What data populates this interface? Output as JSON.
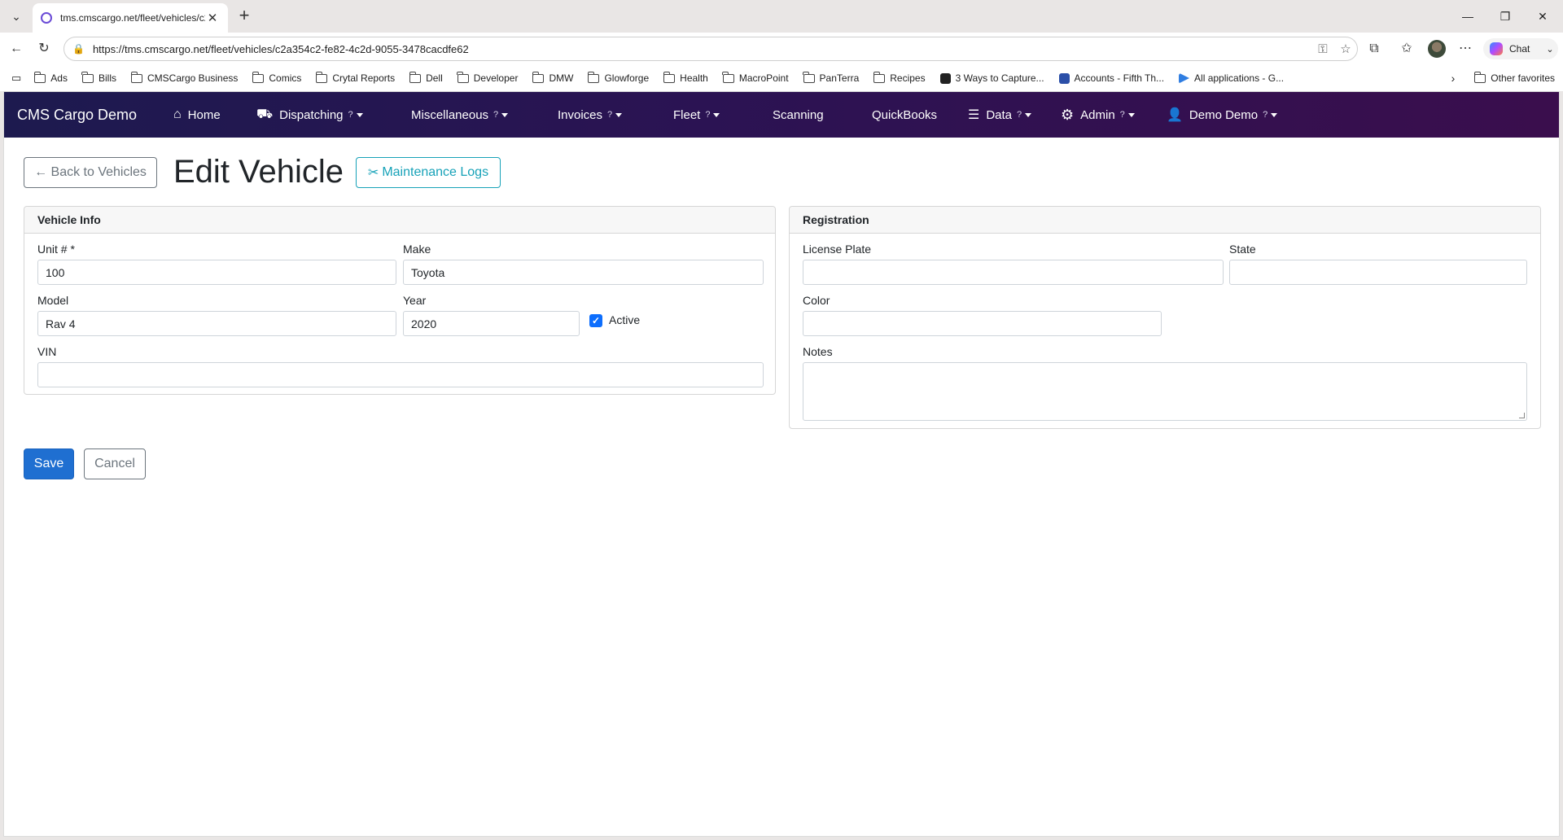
{
  "browser": {
    "tab_title": "tms.cmscargo.net/fleet/vehicles/c2",
    "url": "https://tms.cmscargo.net/fleet/vehicles/c2a354c2-fe82-4c2d-9055-3478cacdfe62",
    "chat_label": "Chat",
    "bookmarks": [
      "Ads",
      "Bills",
      "CMSCargo Business",
      "Comics",
      "Crytal Reports",
      "Dell",
      "Developer",
      "DMW",
      "Glowforge",
      "Health",
      "MacroPoint",
      "PanTerra",
      "Recipes",
      "3 Ways to Capture...",
      "Accounts - Fifth Th...",
      "All applications - G..."
    ],
    "other_favorites": "Other favorites"
  },
  "navbar": {
    "brand": "CMS Cargo Demo",
    "items": [
      {
        "label": "Home",
        "icon": "home-icon"
      },
      {
        "label": "Dispatching",
        "icon": "truck-icon",
        "help": "?"
      },
      {
        "label": "Miscellaneous",
        "help": "?"
      },
      {
        "label": "Invoices",
        "help": "?"
      },
      {
        "label": "Fleet",
        "help": "?"
      },
      {
        "label": "Scanning"
      },
      {
        "label": "QuickBooks"
      },
      {
        "label": "Data",
        "icon": "database-icon",
        "help": "?"
      },
      {
        "label": "Admin",
        "icon": "gear-icon",
        "help": "?"
      },
      {
        "label": "Demo Demo",
        "icon": "user-icon",
        "help": "?"
      }
    ]
  },
  "header": {
    "back_label": "← Back to Vehicles",
    "title": "Edit Vehicle",
    "maintenance_label": "Maintenance Logs"
  },
  "vehicle_info": {
    "title": "Vehicle Info",
    "unit_label": "Unit # *",
    "unit_value": "100",
    "make_label": "Make",
    "make_value": "Toyota",
    "model_label": "Model",
    "model_value": "Rav 4",
    "year_label": "Year",
    "year_value": "2020",
    "active_label": "Active",
    "vin_label": "VIN",
    "vin_value": ""
  },
  "registration": {
    "title": "Registration",
    "plate_label": "License Plate",
    "plate_value": "",
    "state_label": "State",
    "state_value": "",
    "color_label": "Color",
    "color_value": "",
    "notes_label": "Notes",
    "notes_value": ""
  },
  "actions": {
    "save_label": "Save",
    "cancel_label": "Cancel"
  }
}
